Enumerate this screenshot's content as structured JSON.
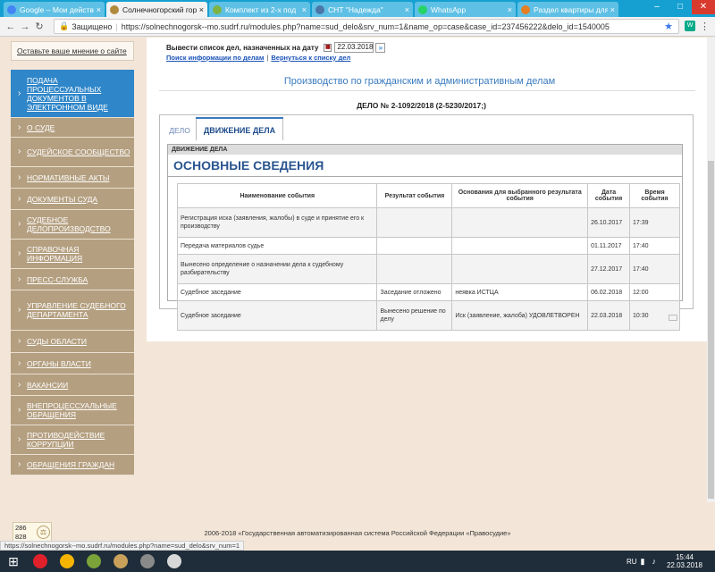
{
  "browser": {
    "tabs": [
      {
        "title": "Google – Мои действ",
        "icon": "google-icon",
        "color": "#4285f4",
        "active": false
      },
      {
        "title": "Солнечногорский гор",
        "icon": "court-emblem-icon",
        "color": "#b08a3c",
        "active": true
      },
      {
        "title": "Комплект из 2-х под",
        "icon": "shop-icon",
        "color": "#7cb342",
        "active": false
      },
      {
        "title": "СНТ \"Надежда\"",
        "icon": "vk-icon",
        "color": "#4a76a8",
        "active": false
      },
      {
        "title": "WhatsApp",
        "icon": "whatsapp-icon",
        "color": "#25d366",
        "active": false
      },
      {
        "title": "Раздел квартиры для",
        "icon": "document-icon",
        "color": "#e67e22",
        "active": false
      }
    ],
    "secure_label": "Защищено",
    "url": "https://solnechnogorsk--mo.sudrf.ru/modules.php?name=sud_delo&srv_num=1&name_op=case&case_id=237456222&delo_id=1540005"
  },
  "sidebar": {
    "opinion_link": "Оставьте ваше мнение о сайте",
    "items": [
      {
        "label": "Подача процессуальных документов в электронном виде",
        "h": 54
      },
      {
        "label": "О суде",
        "h": 22
      },
      {
        "label": "Судейское сообщество",
        "h": 33
      },
      {
        "label": "Нормативные акты",
        "h": 24
      },
      {
        "label": "Документы суда",
        "h": 24
      },
      {
        "label": "Судебное делопроизводство",
        "h": 33
      },
      {
        "label": "Справочная информация",
        "h": 33
      },
      {
        "label": "Пресс-служба",
        "h": 24
      },
      {
        "label": "Управление Судебного департамента",
        "h": 45
      },
      {
        "label": "Суды области",
        "h": 25
      },
      {
        "label": "Органы власти",
        "h": 24
      },
      {
        "label": "Вакансии",
        "h": 24
      },
      {
        "label": "Внепроцессуальные обращения",
        "h": 33
      },
      {
        "label": "Противодействие коррупции",
        "h": 33
      },
      {
        "label": "Обращения граждан",
        "h": 23
      }
    ]
  },
  "filter": {
    "label": "Вывести список дел, назначенных на дату",
    "date_value": "22.03.2018",
    "go_symbol": "»",
    "link_search": "Поиск информации по делам",
    "link_back": "Вернуться к списку дел"
  },
  "page": {
    "production_title": "Производство по гражданским и административным делам",
    "case_number": "ДЕЛО № 2-1092/2018 (2-5230/2017;)"
  },
  "case_tabs": {
    "tab_case": "ДЕЛО",
    "tab_movement": "ДВИЖЕНИЕ ДЕЛА"
  },
  "movement": {
    "section_label": "ДВИЖЕНИЕ ДЕЛА",
    "heading": "ОСНОВНЫЕ СВЕДЕНИЯ",
    "columns": [
      "Наименование события",
      "Результат события",
      "Основания для выбранного результата события",
      "Дата события",
      "Время события"
    ],
    "rows": [
      [
        "Регистрация иска (заявления, жалобы) в суде и принятие его к производству",
        "",
        "",
        "26.10.2017",
        "17:39"
      ],
      [
        "Передача материалов судье",
        "",
        "",
        "01.11.2017",
        "17:40"
      ],
      [
        "Вынесено определение о назначении дела к судебному разбирательству",
        "",
        "",
        "27.12.2017",
        "17:40"
      ],
      [
        "Судебное заседание",
        "Заседание отложено",
        "неявка ИСТЦА",
        "06.02.2018",
        "12:00"
      ],
      [
        "Судебное заседание",
        "Вынесено решение по делу",
        "Иск (заявление, жалоба) УДОВЛЕТВОРЕН",
        "22.03.2018",
        "10:30"
      ]
    ]
  },
  "footer": {
    "counter_top": "286",
    "counter_bottom": "828",
    "copyright": "2006-2018 «Государственная автоматизированная система Российской Федерации «Правосудие»",
    "status_url": "https://solnechnogorsk--mo.sudrf.ru/modules.php?name=sud_delo&srv_num=1"
  },
  "taskbar": {
    "apps": [
      {
        "icon": "opera-icon",
        "color": "#e0202b"
      },
      {
        "icon": "chrome-icon",
        "color": "#f4b400"
      },
      {
        "icon": "game-icon",
        "color": "#7aa33a"
      },
      {
        "icon": "photo-icon",
        "color": "#c9a15a"
      },
      {
        "icon": "app-icon",
        "color": "#8a8a8a"
      },
      {
        "icon": "notepad-icon",
        "color": "#d8d8d8"
      }
    ],
    "language": "RU",
    "time": "15:44",
    "date": "22.03.2018"
  }
}
